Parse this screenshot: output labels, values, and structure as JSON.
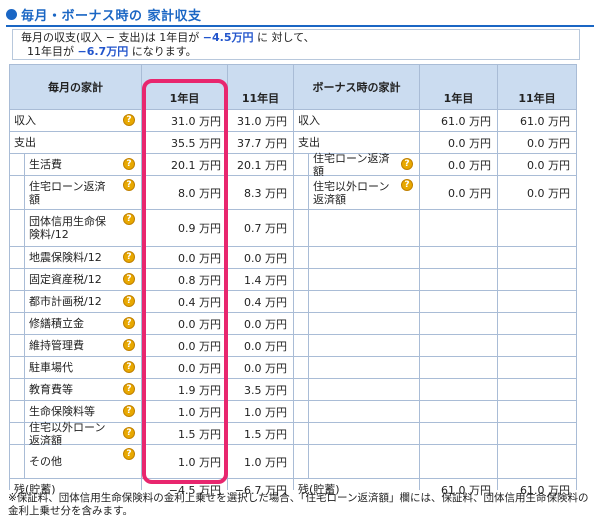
{
  "title": "毎月・ボーナス時の 家計収支",
  "summary": {
    "line1_a": "毎月の収支(収入 − 支出)は 1年目が",
    "line1_value": "−4.5万円",
    "line1_b": "に 対して、",
    "line2_a": "11年目が",
    "line2_value": "−6.7万円",
    "line2_b": "になります。"
  },
  "monthly": {
    "header": "毎月の家計",
    "col1": "1年目",
    "col2": "11年目",
    "rows": [
      {
        "label": "収入",
        "v1": "31.0 万円",
        "v2": "31.0 万円",
        "q": true
      },
      {
        "label": "支出",
        "v1": "35.5 万円",
        "v2": "37.7 万円",
        "q": false
      },
      {
        "label": "生活費",
        "v1": "20.1 万円",
        "v2": "20.1 万円",
        "q": true
      },
      {
        "label": "住宅ローン返済額",
        "v1": "8.0 万円",
        "v2": "8.3 万円",
        "q": true
      },
      {
        "label": "団体信用生命保険料/12",
        "v1": "0.9 万円",
        "v2": "0.7 万円",
        "q": true
      },
      {
        "label": "地震保険料/12",
        "v1": "0.0 万円",
        "v2": "0.0 万円",
        "q": true
      },
      {
        "label": "固定資産税/12",
        "v1": "0.8 万円",
        "v2": "1.4 万円",
        "q": true
      },
      {
        "label": "都市計画税/12",
        "v1": "0.4 万円",
        "v2": "0.4 万円",
        "q": true
      },
      {
        "label": "修繕積立金",
        "v1": "0.0 万円",
        "v2": "0.0 万円",
        "q": true
      },
      {
        "label": "維持管理費",
        "v1": "0.0 万円",
        "v2": "0.0 万円",
        "q": true
      },
      {
        "label": "駐車場代",
        "v1": "0.0 万円",
        "v2": "0.0 万円",
        "q": true
      },
      {
        "label": "教育費等",
        "v1": "1.9 万円",
        "v2": "3.5 万円",
        "q": true
      },
      {
        "label": "生命保険料等",
        "v1": "1.0 万円",
        "v2": "1.0 万円",
        "q": true
      },
      {
        "label": "住宅以外ローン返済額",
        "v1": "1.5 万円",
        "v2": "1.5 万円",
        "q": true
      },
      {
        "label": "その他",
        "v1": "1.0 万円",
        "v2": "1.0 万円",
        "q": true
      },
      {
        "label": "残(貯蓄)",
        "v1": "−4.5 万円",
        "v2": "−6.7 万円",
        "q": false
      }
    ]
  },
  "bonus": {
    "header": "ボーナス時の家計",
    "col1": "1年目",
    "col2": "11年目",
    "rows": [
      {
        "label": "収入",
        "v1": "61.0 万円",
        "v2": "61.0 万円"
      },
      {
        "label": "支出",
        "v1": "0.0 万円",
        "v2": "0.0 万円"
      },
      {
        "label": "住宅ローン返済額",
        "v1": "0.0 万円",
        "v2": "0.0 万円"
      },
      {
        "label": "住宅以外ローン返済額",
        "v1": "0.0 万円",
        "v2": "0.0 万円"
      },
      {
        "label": "残(貯蓄)",
        "v1": "61.0 万円",
        "v2": "61.0 万円"
      }
    ]
  },
  "footnote": "※保証料、団体信用生命保険料の金利上乗せを選択した場合、「住宅ローン返済額」欄には、保証料、団体信用生命保険料の金利上乗せ分を含みます。",
  "colors": {
    "accent": "#1a66c4",
    "highlight": "#e8266e",
    "header_bg": "#cbdcf0",
    "grid": "#a9bcd6",
    "help_icon": "#e8a800"
  }
}
